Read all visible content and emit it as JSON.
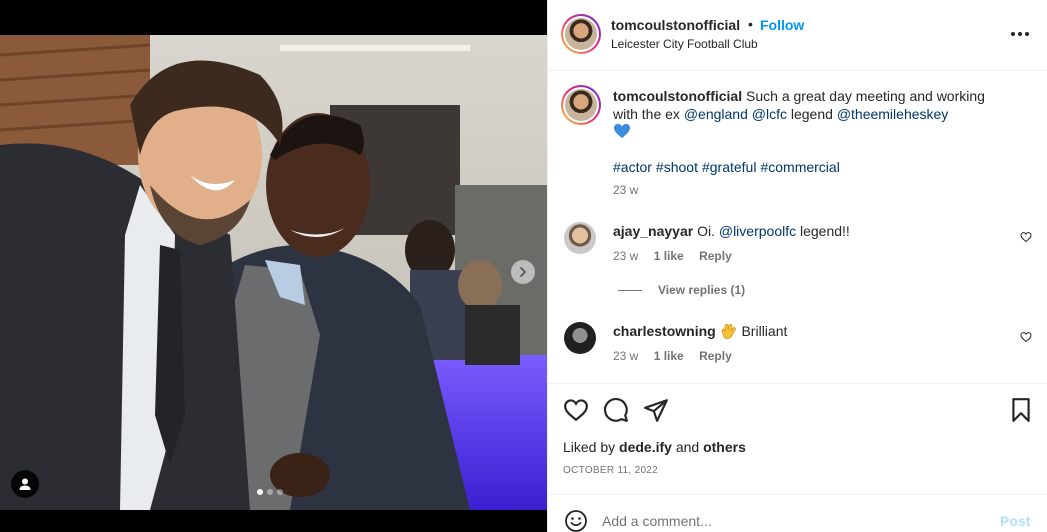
{
  "post": {
    "username": "tomcoulstonofficial",
    "separator": "•",
    "follow_label": "Follow",
    "location": "Leicester City Football Club",
    "carousel": {
      "slides": 3,
      "active_index": 0
    }
  },
  "caption": {
    "username": "tomcoulstonofficial",
    "text_before": "Such a great day meeting and working with the ex",
    "mention_england": "@england",
    "mention_lcfc": "@lcfc",
    "text_legend": "legend",
    "mention_heskey": "@theemileheskey",
    "emoji": "blue-heart",
    "hashtags": [
      "#actor",
      "#shoot",
      "#grateful",
      "#commercial"
    ],
    "time": "23 w"
  },
  "comments": [
    {
      "username": "ajay_nayyar",
      "text_before": "Oi.",
      "mention": "@liverpoolfc",
      "text_after": "legend!!",
      "time": "23 w",
      "likes": "1 like",
      "reply_label": "Reply",
      "view_replies": "View replies (1)"
    },
    {
      "username": "charlestowning",
      "emoji": "clapping-hands",
      "text": "Brilliant",
      "time": "23 w",
      "likes": "1 like",
      "reply_label": "Reply"
    }
  ],
  "actions": {
    "liked_by_prefix": "Liked by",
    "liked_by_user": "dede.ify",
    "liked_by_and": "and",
    "liked_by_others": "others",
    "date": "OCTOBER 11, 2022"
  },
  "add_comment": {
    "placeholder": "Add a comment...",
    "post_label": "Post"
  },
  "colors": {
    "link": "#00376b",
    "follow": "#0095f6",
    "post_disabled": "#b2dffc",
    "muted": "#737373",
    "text": "#262626"
  }
}
